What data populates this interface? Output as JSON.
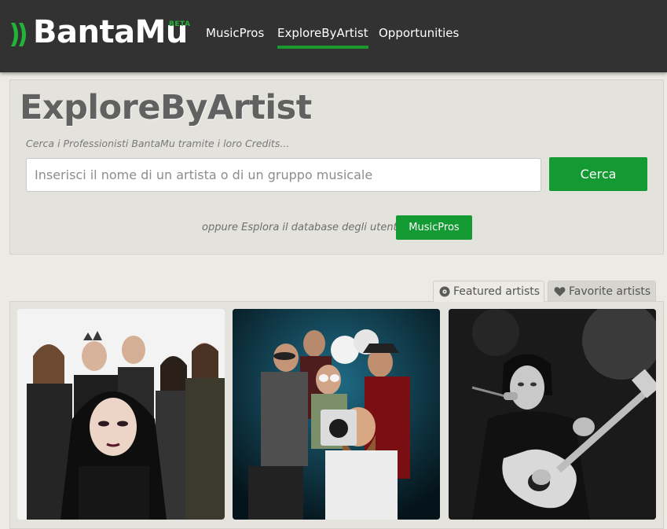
{
  "brand": {
    "name": "BantaMu",
    "badge": "BETA",
    "accent": "#139a32"
  },
  "nav": {
    "items": [
      {
        "label": "MusicPros"
      },
      {
        "label": "ExploreByArtist",
        "active": true
      },
      {
        "label": "Opportunities"
      }
    ]
  },
  "explore": {
    "title": "ExploreByArtist",
    "subtitle": "Cerca i Professionisti BantaMu tramite i loro Credits...",
    "search": {
      "placeholder": "Inserisci il nome di un artista o di un gruppo musicale",
      "value": ""
    },
    "search_button": "Cerca",
    "alternative_text": "oppure Esplora il database degli utenti",
    "musicpros_button": "MusicPros"
  },
  "tabs": [
    {
      "label": "Featured artists",
      "icon": "disc-icon",
      "active": true
    },
    {
      "label": "Favorite artists",
      "icon": "heart-icon",
      "active": false
    }
  ],
  "featured_artists": [
    {
      "image": "band-photo-white-background"
    },
    {
      "image": "band-photo-blue-background"
    },
    {
      "image": "guitarist-photo-black-and-white"
    }
  ]
}
